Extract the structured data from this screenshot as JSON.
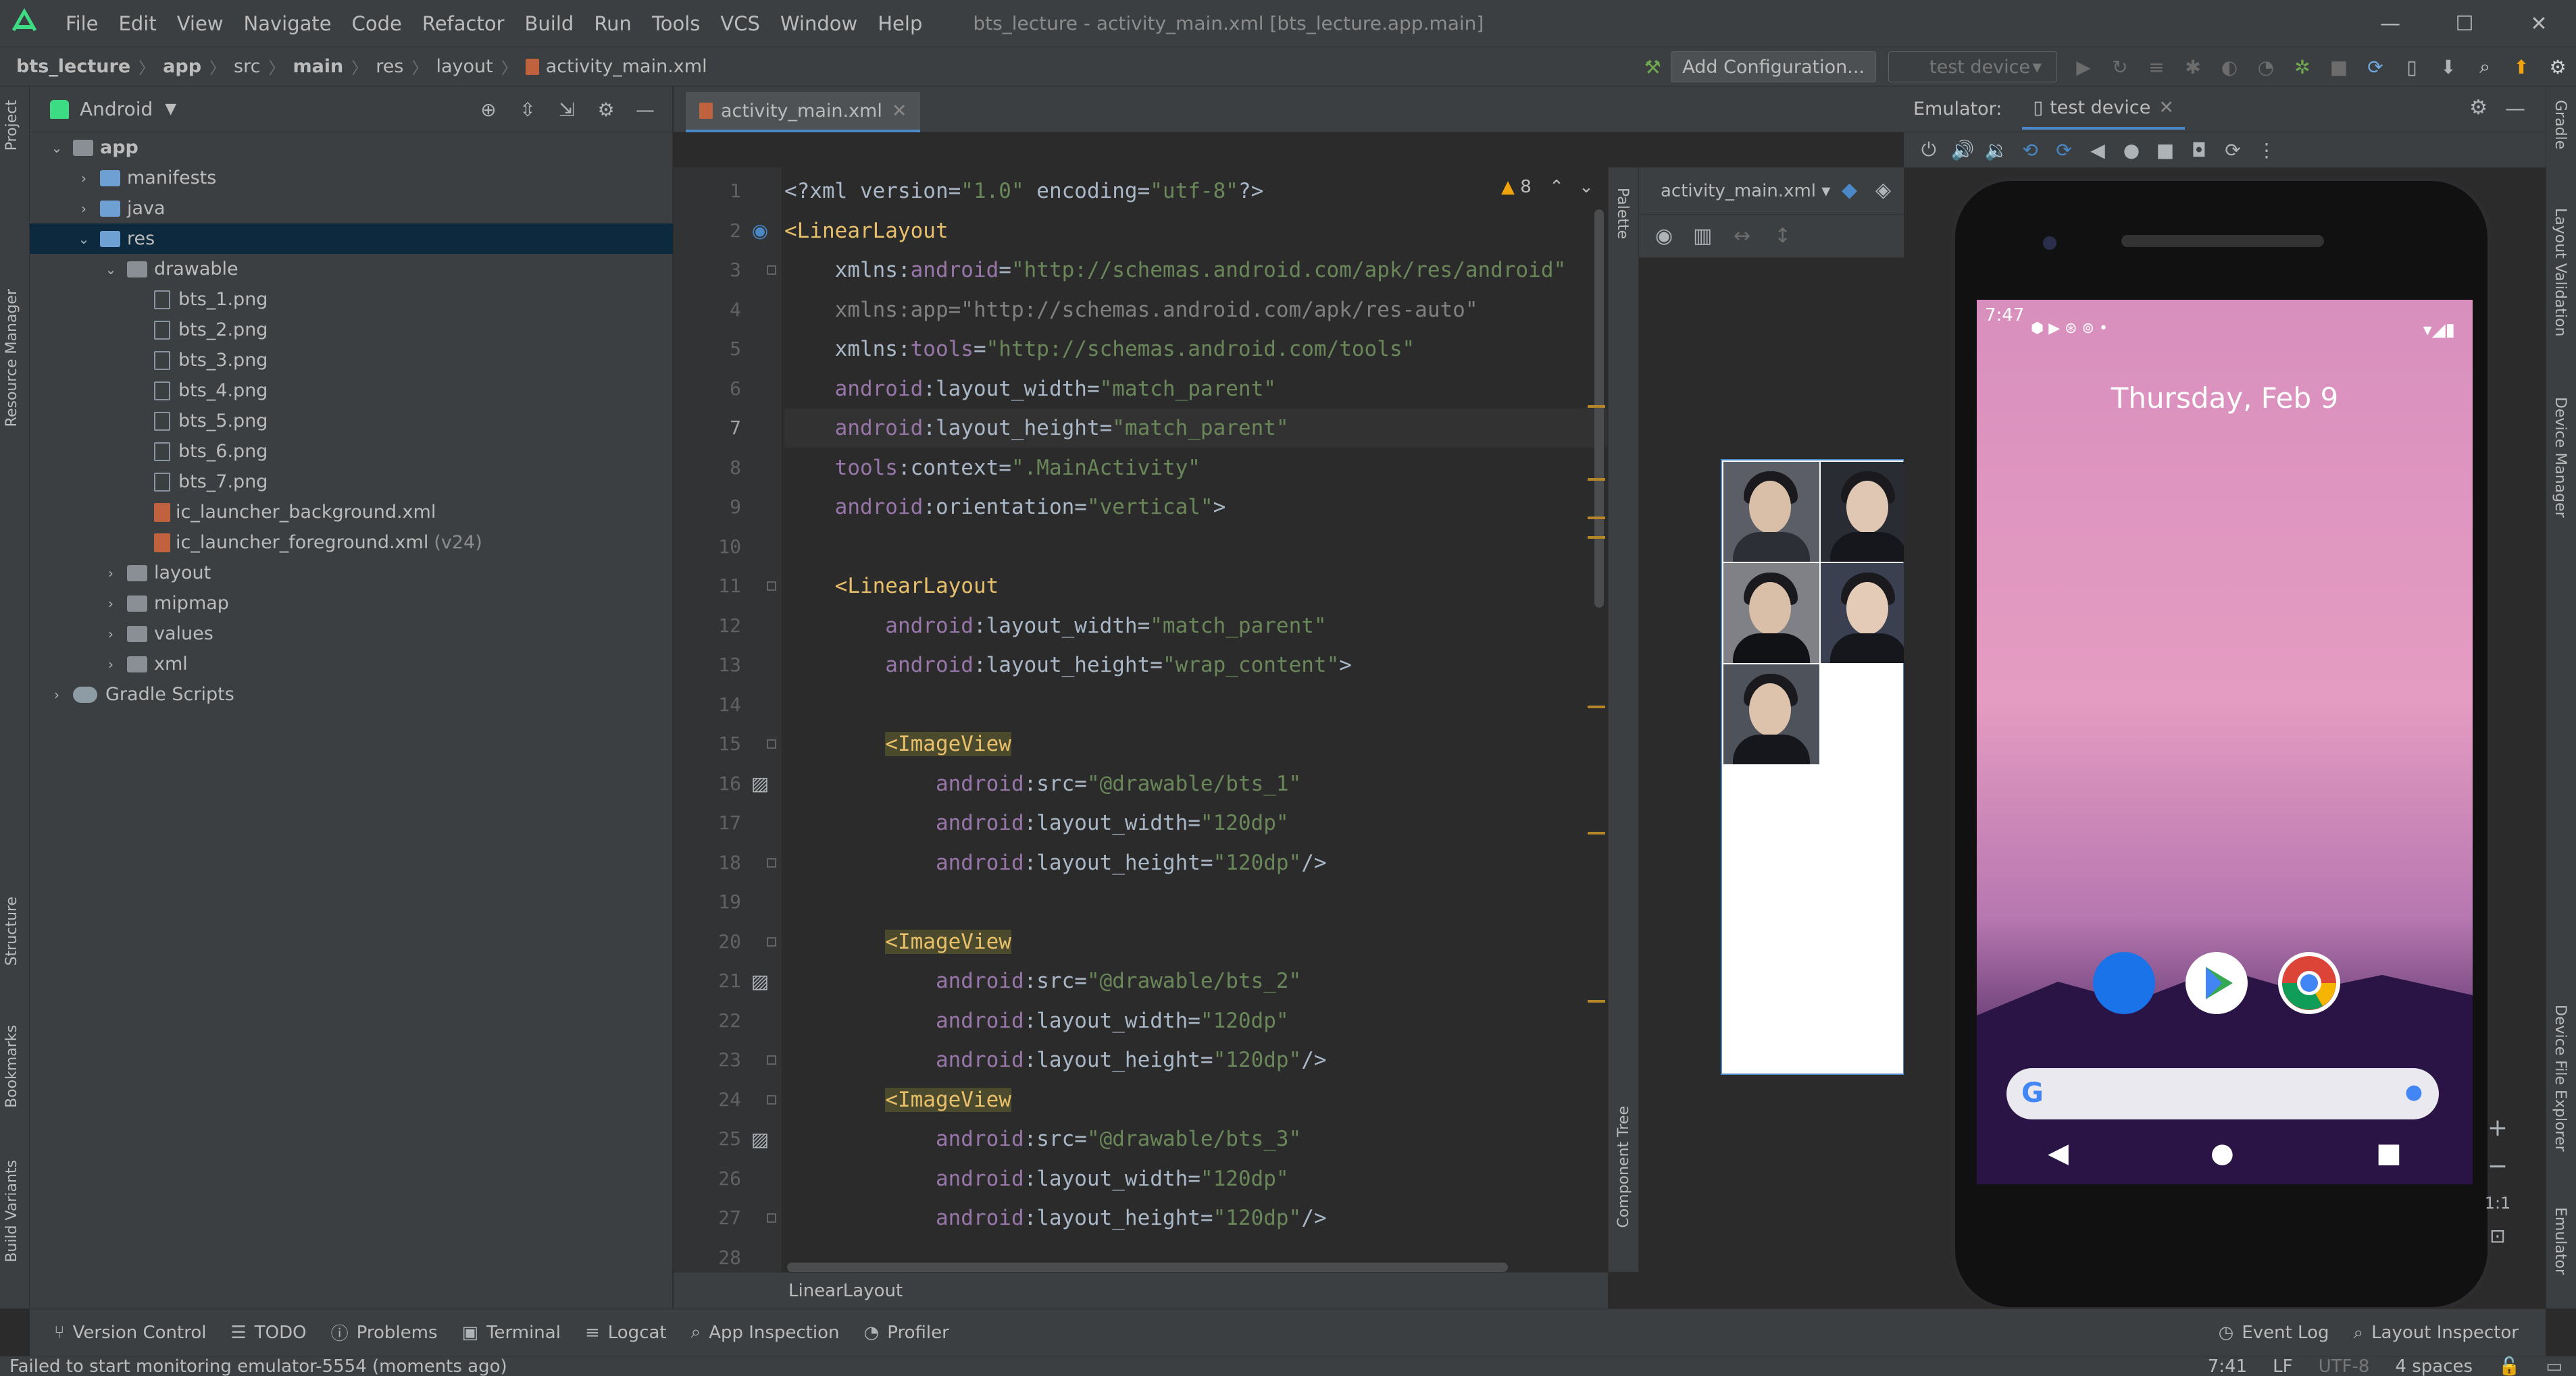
{
  "menubar": {
    "items": [
      "File",
      "Edit",
      "View",
      "Navigate",
      "Code",
      "Refactor",
      "Build",
      "Run",
      "Tools",
      "VCS",
      "Window",
      "Help"
    ],
    "window_title": "bts_lecture - activity_main.xml [bts_lecture.app.main]",
    "controls": [
      "minimize-icon",
      "maximize-icon",
      "close-icon"
    ]
  },
  "navbar": {
    "breadcrumbs": [
      "bts_lecture",
      "app",
      "src",
      "main",
      "res",
      "layout",
      "activity_main.xml"
    ],
    "add_config_label": "Add Configuration...",
    "device_selector": "test device"
  },
  "left_strip": {
    "tabs": [
      "Project",
      "Resource Manager",
      "Structure",
      "Bookmarks",
      "Build Variants"
    ]
  },
  "right_strip": {
    "tabs": [
      "Gradle",
      "Layout Validation",
      "Device Manager",
      "Device File Explorer",
      "Emulator"
    ]
  },
  "project": {
    "title": "Android",
    "tree": [
      {
        "label": "app",
        "depth": 0,
        "kind": "module",
        "open": true
      },
      {
        "label": "manifests",
        "depth": 1,
        "kind": "folder-blue",
        "open": false
      },
      {
        "label": "java",
        "depth": 1,
        "kind": "folder-blue",
        "open": false
      },
      {
        "label": "res",
        "depth": 1,
        "kind": "folder-blue",
        "open": true,
        "selected": true
      },
      {
        "label": "drawable",
        "depth": 2,
        "kind": "folder",
        "open": true
      },
      {
        "label": "bts_1.png",
        "depth": 3,
        "kind": "image"
      },
      {
        "label": "bts_2.png",
        "depth": 3,
        "kind": "image"
      },
      {
        "label": "bts_3.png",
        "depth": 3,
        "kind": "image"
      },
      {
        "label": "bts_4.png",
        "depth": 3,
        "kind": "image"
      },
      {
        "label": "bts_5.png",
        "depth": 3,
        "kind": "image"
      },
      {
        "label": "bts_6.png",
        "depth": 3,
        "kind": "image"
      },
      {
        "label": "bts_7.png",
        "depth": 3,
        "kind": "image"
      },
      {
        "label": "ic_launcher_background.xml",
        "depth": 3,
        "kind": "xml"
      },
      {
        "label": "ic_launcher_foreground.xml",
        "depth": 3,
        "kind": "xml",
        "suffix": "(v24)"
      },
      {
        "label": "layout",
        "depth": 2,
        "kind": "folder",
        "open": false
      },
      {
        "label": "mipmap",
        "depth": 2,
        "kind": "folder",
        "open": false
      },
      {
        "label": "values",
        "depth": 2,
        "kind": "folder",
        "open": false
      },
      {
        "label": "xml",
        "depth": 2,
        "kind": "folder",
        "open": false
      },
      {
        "label": "Gradle Scripts",
        "depth": 0,
        "kind": "gradle",
        "open": false
      }
    ]
  },
  "editor": {
    "tab_label": "activity_main.xml",
    "warnings": "8",
    "breadcrumb_tag": "LinearLayout",
    "lines": [
      [
        [
          "plain",
          "<?xml version="
        ],
        [
          "val",
          "\"1.0\""
        ],
        [
          "plain",
          " encoding="
        ],
        [
          "val",
          "\"utf-8\""
        ],
        [
          "plain",
          "?>"
        ]
      ],
      [
        [
          "tag",
          "<LinearLayout"
        ]
      ],
      [
        [
          "plain",
          "    xmlns:"
        ],
        [
          "attr",
          "android"
        ],
        [
          "plain",
          "="
        ],
        [
          "val",
          "\"http://schemas.android.com/apk/res/android\""
        ]
      ],
      [
        [
          "gray",
          "    xmlns:app=\"http://schemas.android.com/apk/res-auto\""
        ]
      ],
      [
        [
          "plain",
          "    xmlns:"
        ],
        [
          "attr",
          "tools"
        ],
        [
          "plain",
          "="
        ],
        [
          "val",
          "\"http://schemas.android.com/tools\""
        ]
      ],
      [
        [
          "attr",
          "    android"
        ],
        [
          "plain",
          ":layout_width="
        ],
        [
          "val",
          "\"match_parent\""
        ]
      ],
      [
        [
          "attr",
          "    android"
        ],
        [
          "plain",
          ":layout_height="
        ],
        [
          "val",
          "\"match_parent\""
        ]
      ],
      [
        [
          "attr",
          "    tools"
        ],
        [
          "plain",
          ":context="
        ],
        [
          "val",
          "\".MainActivity\""
        ]
      ],
      [
        [
          "attr",
          "    android"
        ],
        [
          "plain",
          ":orientation="
        ],
        [
          "val",
          "\"vertical\""
        ],
        [
          "plain",
          ">"
        ]
      ],
      [
        [
          "plain",
          ""
        ]
      ],
      [
        [
          "tag",
          "    <LinearLayout"
        ]
      ],
      [
        [
          "attr",
          "        android"
        ],
        [
          "plain",
          ":layout_width="
        ],
        [
          "val",
          "\"match_parent\""
        ]
      ],
      [
        [
          "attr",
          "        android"
        ],
        [
          "plain",
          ":layout_height="
        ],
        [
          "val",
          "\"wrap_content\""
        ],
        [
          "plain",
          ">"
        ]
      ],
      [
        [
          "plain",
          ""
        ]
      ],
      [
        [
          "plain",
          "        "
        ],
        [
          "tag-hl",
          "<ImageView"
        ]
      ],
      [
        [
          "attr",
          "            android"
        ],
        [
          "plain",
          ":src="
        ],
        [
          "val",
          "\"@drawable/bts_1\""
        ]
      ],
      [
        [
          "attr",
          "            android"
        ],
        [
          "plain",
          ":layout_width="
        ],
        [
          "val",
          "\"120dp\""
        ]
      ],
      [
        [
          "attr",
          "            android"
        ],
        [
          "plain",
          ":layout_height="
        ],
        [
          "val",
          "\"120dp\""
        ],
        [
          "plain",
          "/>"
        ]
      ],
      [
        [
          "plain",
          ""
        ]
      ],
      [
        [
          "plain",
          "        "
        ],
        [
          "tag-hl",
          "<ImageView"
        ]
      ],
      [
        [
          "attr",
          "            android"
        ],
        [
          "plain",
          ":src="
        ],
        [
          "val",
          "\"@drawable/bts_2\""
        ]
      ],
      [
        [
          "attr",
          "            android"
        ],
        [
          "plain",
          ":layout_width="
        ],
        [
          "val",
          "\"120dp\""
        ]
      ],
      [
        [
          "attr",
          "            android"
        ],
        [
          "plain",
          ":layout_height="
        ],
        [
          "val",
          "\"120dp\""
        ],
        [
          "plain",
          "/>"
        ]
      ],
      [
        [
          "plain",
          "        "
        ],
        [
          "tag-hl",
          "<ImageView"
        ]
      ],
      [
        [
          "attr",
          "            android"
        ],
        [
          "plain",
          ":src="
        ],
        [
          "val",
          "\"@drawable/bts_3\""
        ]
      ],
      [
        [
          "attr",
          "            android"
        ],
        [
          "plain",
          ":layout_width="
        ],
        [
          "val",
          "\"120dp\""
        ]
      ],
      [
        [
          "attr",
          "            android"
        ],
        [
          "plain",
          ":layout_height="
        ],
        [
          "val",
          "\"120dp\""
        ],
        [
          "plain",
          "/>"
        ]
      ],
      [
        [
          "plain",
          ""
        ]
      ]
    ]
  },
  "design": {
    "palette_label": "Palette",
    "component_tree_label": "Component Tree",
    "file_selector": "activity_main.xml"
  },
  "emulator": {
    "header_label": "Emulator:",
    "tab_label": "test device",
    "phone_time": "7:47",
    "phone_date": "Thursday, Feb 9",
    "zoom_label": "1:1"
  },
  "toolwindows": {
    "left": [
      "Version Control",
      "TODO",
      "Problems",
      "Terminal",
      "Logcat",
      "App Inspection",
      "Profiler"
    ],
    "right": [
      "Event Log",
      "Layout Inspector"
    ]
  },
  "status": {
    "message": "Failed to start monitoring emulator-5554 (moments ago)",
    "position": "7:41",
    "line_sep": "LF",
    "encoding": "UTF-8",
    "indent": "4 spaces"
  }
}
